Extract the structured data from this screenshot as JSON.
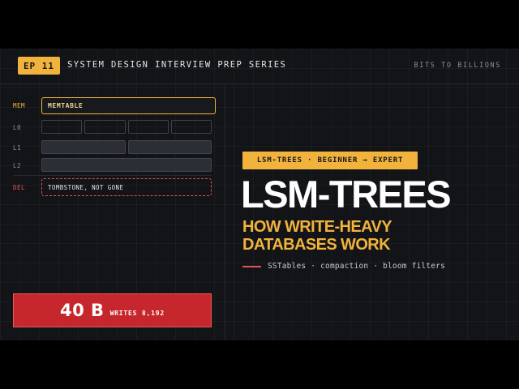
{
  "header": {
    "episode_badge": "EP 11",
    "series_title": "SYSTEM DESIGN INTERVIEW PREP SERIES",
    "brand": "BITS TO BILLIONS"
  },
  "diagram": {
    "levels": [
      {
        "label": "MEM",
        "content": "MEMTABLE"
      },
      {
        "label": "L0",
        "sstable_count": 4
      },
      {
        "label": "L1",
        "sstable_count": 2
      },
      {
        "label": "L2",
        "sstable_count": 1
      },
      {
        "label": "DEL",
        "content": "TOMBSTONE, NOT GONE"
      }
    ]
  },
  "stat": {
    "value": "40 B",
    "caption": "WRITES 8,192"
  },
  "hero": {
    "tag": "LSM-TREES · BEGINNER → EXPERT",
    "title": "LSM-TREES",
    "subtitle_line1": "HOW WRITE-HEAVY",
    "subtitle_line2": "DATABASES WORK",
    "topics": "SSTables · compaction · bloom filters"
  },
  "colors": {
    "accent": "#f2b33d",
    "danger": "#e55353",
    "stat_bg": "#c6272d",
    "background": "#121417"
  }
}
